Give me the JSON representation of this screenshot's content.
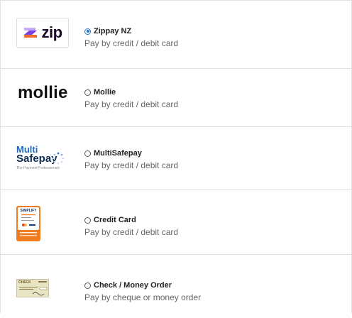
{
  "payment_methods": [
    {
      "logo": "Zippay zip logo",
      "logo_text": "zip",
      "title": "Zippay NZ",
      "description": "Pay by credit / debit card",
      "selected": true
    },
    {
      "logo": "Mollie logo",
      "logo_text": "mollie",
      "title": "Mollie",
      "description": "Pay by credit / debit card",
      "selected": false
    },
    {
      "logo": "MultiSafepay logo",
      "logo_text_line1": "Multi",
      "logo_text_line2": "Safepay",
      "logo_tagline": "The Payment Professionals",
      "title": "MultiSafepay",
      "description": "Pay by credit / debit card",
      "selected": false
    },
    {
      "logo": "Simplify Commerce logo",
      "logo_text": "SIMPLIFY",
      "title": "Credit Card",
      "description": "Pay by credit / debit card",
      "selected": false
    },
    {
      "logo": "Check image",
      "logo_text": "CHECK",
      "title": "Check / Money Order",
      "description": "Pay by cheque or money order",
      "selected": false
    }
  ],
  "colors": {
    "radio_selected": "#1d73d1",
    "zip_purple": "#7b3fe4",
    "zip_orange": "#f06b2a",
    "msp_blue": "#1b69c8",
    "simplify_orange": "#f07c20"
  }
}
